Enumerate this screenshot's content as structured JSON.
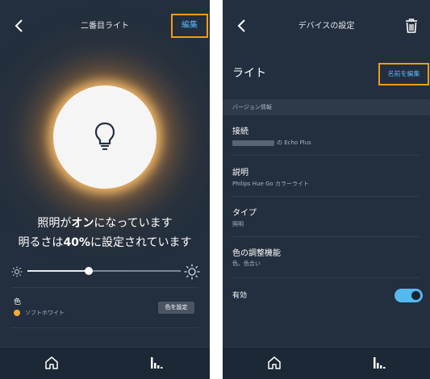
{
  "light_screen": {
    "header": {
      "title": "二番目ライト",
      "edit_label": "編集"
    },
    "status": {
      "line1_pre": "照明が",
      "line1_bold": "オン",
      "line1_post": "になっています",
      "line2_pre": "明るさは",
      "line2_bold": "40%",
      "line2_post": "に設定されています"
    },
    "brightness": {
      "value_fraction": 0.4
    },
    "color": {
      "label": "色",
      "current": "ソフトホワイト",
      "swatch": "#f5a93a",
      "set_button": "色を設定"
    }
  },
  "settings_screen": {
    "header": {
      "title": "デバイスの設定"
    },
    "device_name": "ライト",
    "rename_label": "名前を編集",
    "section_header": "バージョン情報",
    "rows": [
      {
        "title": "接続",
        "value": "の Echo Plus"
      },
      {
        "title": "説明",
        "value": "Philips Hue Go カラーライト"
      },
      {
        "title": "タイプ",
        "value": "照明"
      },
      {
        "title": "色の調整機能",
        "value": "色、色合い"
      }
    ],
    "enabled_label": "有効",
    "enabled": true
  },
  "colors": {
    "background": "#232f3e",
    "accent_blue": "#57b8ff",
    "highlight_orange": "#f39c12",
    "toggle_on": "#55b8ef"
  },
  "icons": [
    "back-icon",
    "bulb-icon",
    "sun-small-icon",
    "sun-large-icon",
    "home-icon",
    "stats-icon",
    "trash-icon"
  ]
}
